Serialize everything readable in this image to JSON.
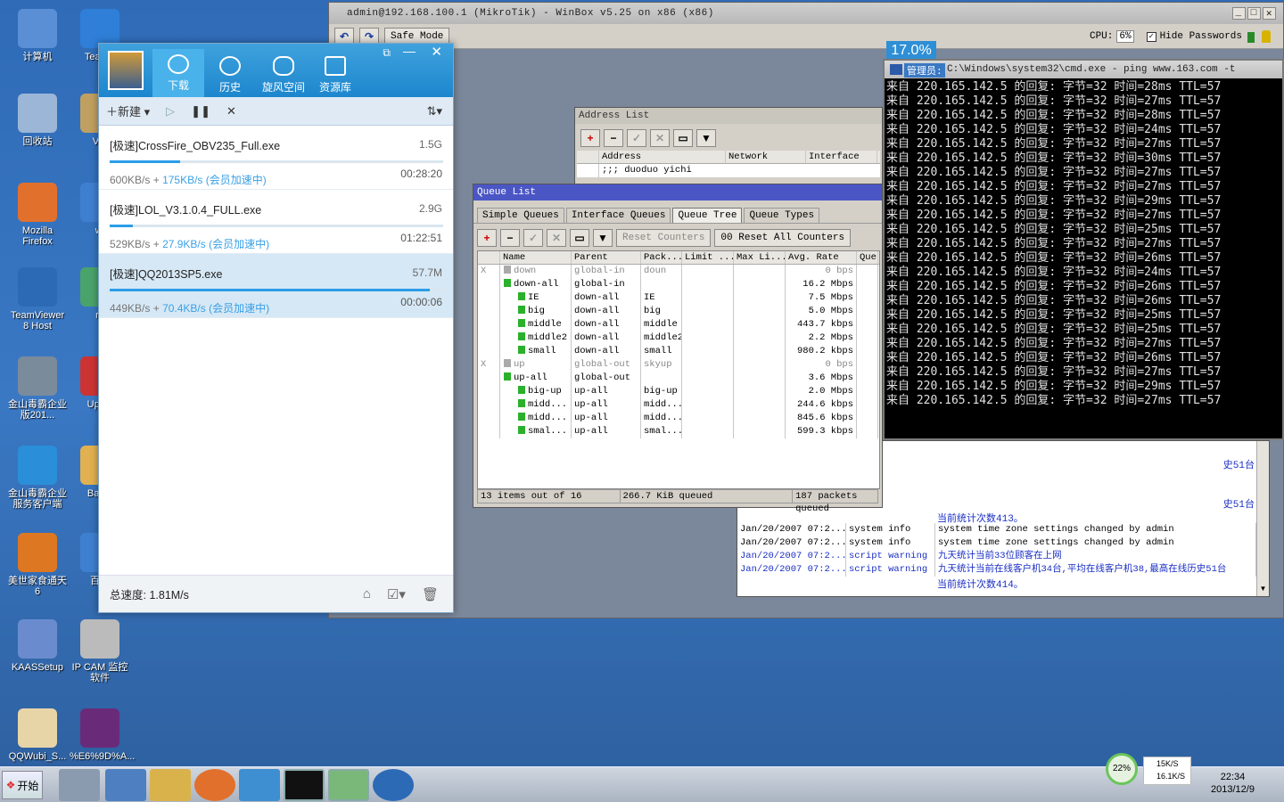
{
  "desktop": {
    "icons": [
      {
        "label": "计算机"
      },
      {
        "label": "TeamV"
      },
      {
        "label": "回收站"
      },
      {
        "label": "VM"
      },
      {
        "label": "Mozilla Firefox"
      },
      {
        "label": "wi"
      },
      {
        "label": "TeamViewer 8 Host"
      },
      {
        "label": "ro"
      },
      {
        "label": "金山毒霸企业版201..."
      },
      {
        "label": "Uploa"
      },
      {
        "label": "金山毒霸企业服务客户端"
      },
      {
        "label": "Baidu"
      },
      {
        "label": "美世家食通天6"
      },
      {
        "label": "百度"
      },
      {
        "label": "KAASSetup"
      },
      {
        "label": "IP CAM 监控软件"
      },
      {
        "label": "QQWubi_S..."
      },
      {
        "label": "%E6%9D%A..."
      }
    ]
  },
  "winbox": {
    "title": "admin@192.168.100.1 (MikroTik) - WinBox v5.25 on x86 (x86)",
    "safe_mode": "Safe Mode",
    "cpu_label": "CPU:",
    "cpu_value": "6%",
    "hide_passwords": "Hide Passwords",
    "cpu_overlay": "17.0%"
  },
  "address_list": {
    "title": "Address List",
    "headers": [
      "Address",
      "Network",
      "Interface"
    ],
    "row": ";;; duoduo yichi"
  },
  "queue_list": {
    "title": "Queue List",
    "tabs": [
      "Simple Queues",
      "Interface Queues",
      "Queue Tree",
      "Queue Types"
    ],
    "reset_counters": "Reset Counters",
    "reset_all_counters": "00 Reset All Counters",
    "headers": [
      "Name",
      "Parent",
      "Pack...",
      "Limit ...",
      "Max Li...",
      "Avg. Rate",
      "Que"
    ],
    "rows": [
      {
        "flag": "X",
        "name": "down",
        "parent": "global-in",
        "pack": "doun",
        "rate": "0 bps",
        "disabled": true,
        "indent": 0
      },
      {
        "flag": "",
        "name": "down-all",
        "parent": "global-in",
        "pack": "",
        "rate": "16.2 Mbps",
        "disabled": false,
        "indent": 0
      },
      {
        "flag": "",
        "name": "IE",
        "parent": "down-all",
        "pack": "IE",
        "rate": "7.5 Mbps",
        "disabled": false,
        "indent": 1
      },
      {
        "flag": "",
        "name": "big",
        "parent": "down-all",
        "pack": "big",
        "rate": "5.0 Mbps",
        "disabled": false,
        "indent": 1
      },
      {
        "flag": "",
        "name": "middle",
        "parent": "down-all",
        "pack": "middle",
        "rate": "443.7 kbps",
        "disabled": false,
        "indent": 1
      },
      {
        "flag": "",
        "name": "middle2",
        "parent": "down-all",
        "pack": "middle2",
        "rate": "2.2 Mbps",
        "disabled": false,
        "indent": 1
      },
      {
        "flag": "",
        "name": "small",
        "parent": "down-all",
        "pack": "small",
        "rate": "980.2 kbps",
        "disabled": false,
        "indent": 1
      },
      {
        "flag": "X",
        "name": "up",
        "parent": "global-out",
        "pack": "skyup",
        "rate": "0 bps",
        "disabled": true,
        "indent": 0
      },
      {
        "flag": "",
        "name": "up-all",
        "parent": "global-out",
        "pack": "",
        "rate": "3.6 Mbps",
        "disabled": false,
        "indent": 0
      },
      {
        "flag": "",
        "name": "big-up",
        "parent": "up-all",
        "pack": "big-up",
        "rate": "2.0 Mbps",
        "disabled": false,
        "indent": 1
      },
      {
        "flag": "",
        "name": "midd...",
        "parent": "up-all",
        "pack": "midd...",
        "rate": "244.6 kbps",
        "disabled": false,
        "indent": 1
      },
      {
        "flag": "",
        "name": "midd...",
        "parent": "up-all",
        "pack": "midd...",
        "rate": "845.6 kbps",
        "disabled": false,
        "indent": 1
      },
      {
        "flag": "",
        "name": "smal...",
        "parent": "up-all",
        "pack": "smal...",
        "rate": "599.3 kbps",
        "disabled": false,
        "indent": 1
      }
    ],
    "status_items": "13 items out of 16",
    "status_queued": "266.7 KiB queued",
    "status_packets": "187 packets queued"
  },
  "log": {
    "partial": [
      "史51台",
      "史51台",
      "当前统计次数413。"
    ],
    "rows": [
      {
        "time": "Jan/20/2007 07:2...",
        "topic": "system info",
        "msg": "system time zone settings changed by admin",
        "blue": false
      },
      {
        "time": "Jan/20/2007 07:2...",
        "topic": "system info",
        "msg": "system time zone settings changed by admin",
        "blue": false
      },
      {
        "time": "Jan/20/2007 07:2...",
        "topic": "script warning",
        "msg": "九天统计当前33位顾客在上网",
        "blue": true
      },
      {
        "time": "Jan/20/2007 07:2...",
        "topic": "script warning",
        "msg": "九天统计当前在线客户机34台,平均在线客户机38,最高在线历史51台",
        "blue": true
      }
    ],
    "tail": "当前统计次数414。"
  },
  "cmd": {
    "title": "C:\\Windows\\system32\\cmd.exe - ping  www.163.com  -t",
    "title_prefix": "管理员:",
    "lines": [
      "来自 220.165.142.5 的回复: 字节=32 时间=28ms TTL=57",
      "来自 220.165.142.5 的回复: 字节=32 时间=27ms TTL=57",
      "来自 220.165.142.5 的回复: 字节=32 时间=28ms TTL=57",
      "来自 220.165.142.5 的回复: 字节=32 时间=24ms TTL=57",
      "来自 220.165.142.5 的回复: 字节=32 时间=27ms TTL=57",
      "来自 220.165.142.5 的回复: 字节=32 时间=30ms TTL=57",
      "来自 220.165.142.5 的回复: 字节=32 时间=27ms TTL=57",
      "来自 220.165.142.5 的回复: 字节=32 时间=27ms TTL=57",
      "来自 220.165.142.5 的回复: 字节=32 时间=29ms TTL=57",
      "来自 220.165.142.5 的回复: 字节=32 时间=27ms TTL=57",
      "来自 220.165.142.5 的回复: 字节=32 时间=25ms TTL=57",
      "来自 220.165.142.5 的回复: 字节=32 时间=27ms TTL=57",
      "来自 220.165.142.5 的回复: 字节=32 时间=26ms TTL=57",
      "来自 220.165.142.5 的回复: 字节=32 时间=24ms TTL=57",
      "来自 220.165.142.5 的回复: 字节=32 时间=26ms TTL=57",
      "来自 220.165.142.5 的回复: 字节=32 时间=26ms TTL=57",
      "来自 220.165.142.5 的回复: 字节=32 时间=25ms TTL=57",
      "来自 220.165.142.5 的回复: 字节=32 时间=25ms TTL=57",
      "来自 220.165.142.5 的回复: 字节=32 时间=27ms TTL=57",
      "来自 220.165.142.5 的回复: 字节=32 时间=26ms TTL=57",
      "来自 220.165.142.5 的回复: 字节=32 时间=27ms TTL=57",
      "来自 220.165.142.5 的回复: 字节=32 时间=29ms TTL=57",
      "来自 220.165.142.5 的回复: 字节=32 时间=27ms TTL=57"
    ]
  },
  "xunlei": {
    "nav": [
      "下载",
      "历史",
      "旋风空间",
      "资源库"
    ],
    "new_label": "新建",
    "downloads": [
      {
        "name": "[极速]CrossFire_OBV235_Full.exe",
        "size": "1.5G",
        "progress": 0.21,
        "speed": "600KB/s",
        "boost": "175KB/s (会员加速中)",
        "eta": "00:28:20"
      },
      {
        "name": "[极速]LOL_V3.1.0.4_FULL.exe",
        "size": "2.9G",
        "progress": 0.07,
        "speed": "529KB/s",
        "boost": "27.9KB/s (会员加速中)",
        "eta": "01:22:51"
      },
      {
        "name": "[极速]QQ2013SP5.exe",
        "size": "57.7M",
        "progress": 0.96,
        "speed": "449KB/s",
        "boost": "70.4KB/s (会员加速中)",
        "eta": "00:00:06"
      }
    ],
    "total_speed": "总速度: 1.81M/s",
    "plus": "+"
  },
  "taskbar": {
    "start": "开始",
    "net_percent": "22%",
    "up_speed": "15K/S",
    "down_speed": "16.1K/S",
    "time": "22:34",
    "date": "2013/12/9"
  }
}
